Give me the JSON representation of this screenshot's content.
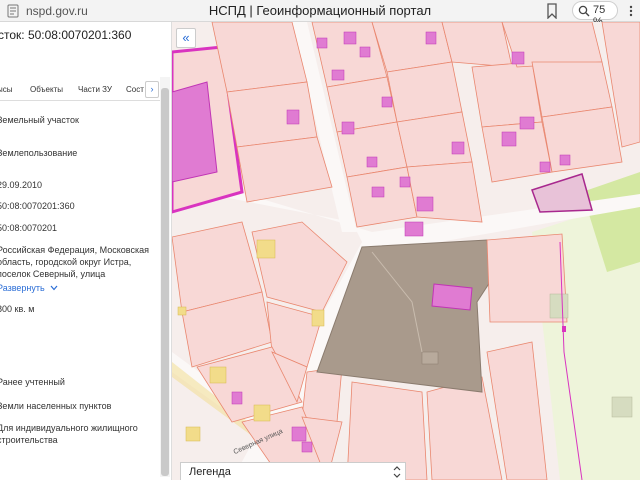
{
  "browser": {
    "url": "nspd.gov.ru",
    "title": "НСПД | Геоинформационный портал",
    "zoom": "75 %"
  },
  "panel": {
    "title": "сток: 50:08:0070201:360",
    "tabs": [
      "ысы",
      "Объекты",
      "Части ЗУ",
      "Сост"
    ],
    "fields": [
      "Земельный участок",
      "Землепользование",
      "29.09.2010",
      "50:08:0070201:360",
      "50:08:0070201",
      "Российская Федерация, Московская",
      "область, городской округ Истра,",
      "поселок Северный, улица",
      "Развернуть",
      "800 кв. м",
      "-",
      "-",
      "Ранее учтенный",
      "Земли населенных пунктов",
      "Для индивидуального жилищного",
      "строительства",
      "-"
    ]
  },
  "map": {
    "street_label": "Северная улица",
    "legend_label": "Легенда"
  },
  "colors": {
    "parcel_fill": "#f8d8d6",
    "parcel_border": "#e9876f",
    "building": "#e07bd2",
    "building_border": "#c035b5",
    "selected": "#a99a8c",
    "green": "#d4e8a2",
    "yellow": "#f2dc8a",
    "accent": "#2a6dd6"
  }
}
